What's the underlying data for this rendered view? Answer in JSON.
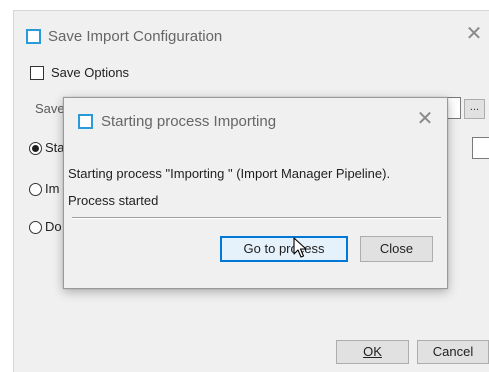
{
  "outer_dialog": {
    "title": "Save Import Configuration",
    "close_glyph": "✕",
    "save_options_label": "Save Options",
    "save_as_label": "Save",
    "browse_label": "...",
    "radio_options": [
      {
        "label": "Sta",
        "checked": true
      },
      {
        "label": "Im",
        "checked": false
      },
      {
        "label": "Do",
        "checked": false
      }
    ],
    "ok_label": "OK",
    "cancel_label": "Cancel"
  },
  "inner_dialog": {
    "title": "Starting process Importing",
    "close_glyph": "✕",
    "message_line1": "Starting process \"Importing \" (Import Manager Pipeline).",
    "message_line2": "Process started",
    "goto_label": "Go to process",
    "close_label": "Close"
  },
  "colors": {
    "icon_border": "#2a9bd8",
    "dialog_bg": "#f0f0f0",
    "default_button_border": "#0078d7"
  },
  "icons": {
    "app_icon": "window-icon",
    "close_icon": "close-icon",
    "cursor": "mouse-pointer-icon"
  }
}
